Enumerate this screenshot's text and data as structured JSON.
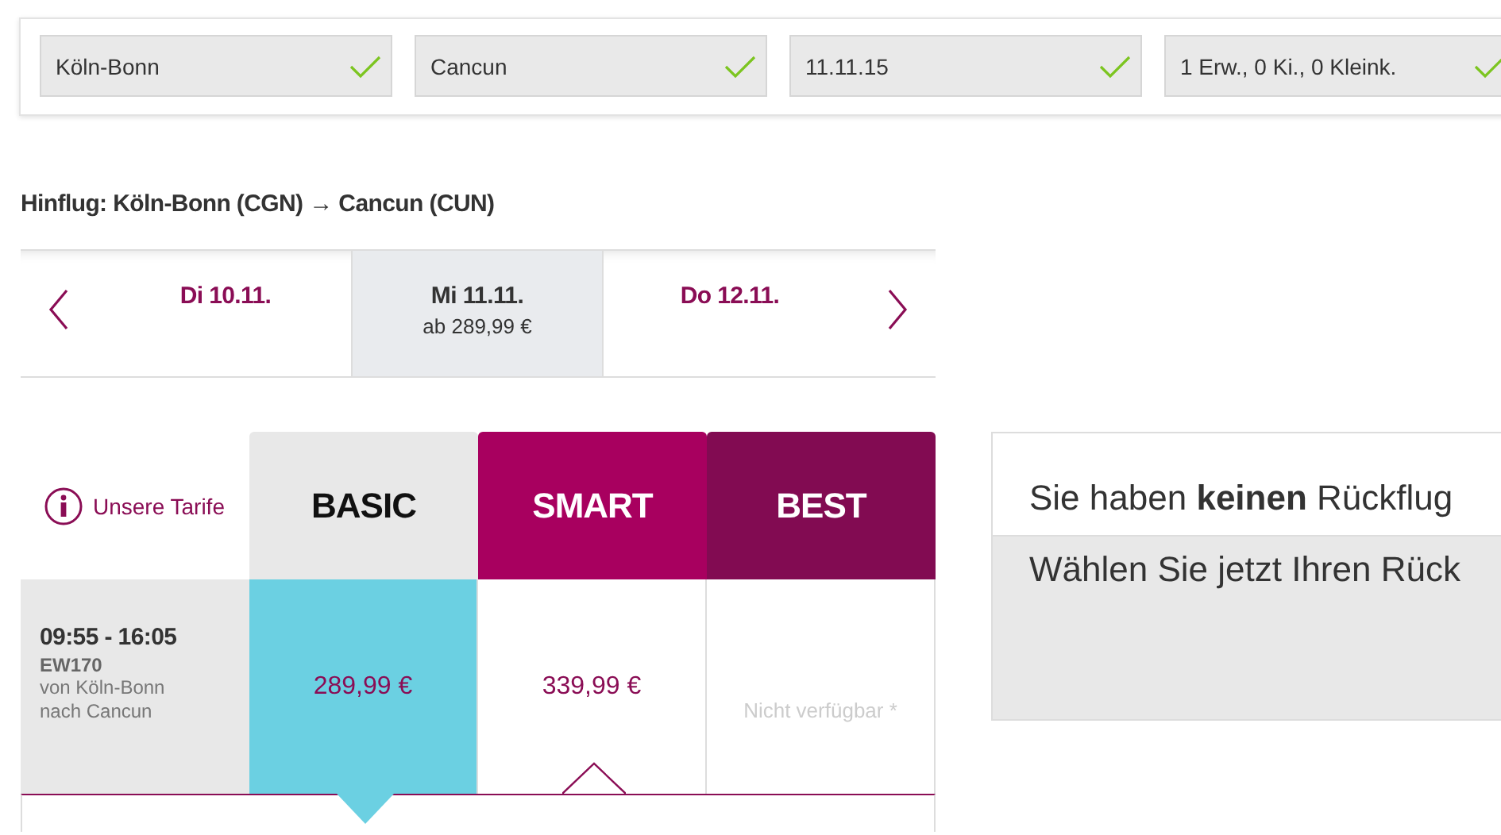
{
  "search_fields": [
    {
      "value": "Köln-Bonn",
      "valid": true
    },
    {
      "value": "Cancun",
      "valid": true
    },
    {
      "value": "11.11.15",
      "valid": true
    },
    {
      "value": "1 Erw., 0 Ki., 0 Kleink.",
      "valid": true
    }
  ],
  "outbound": {
    "heading": "Hinflug: Köln-Bonn (CGN) → Cancun (CUN)",
    "days": [
      {
        "label": "Di 10.11.",
        "selected": false
      },
      {
        "label": "Mi 11.11.",
        "price": "ab 289,99 €",
        "selected": true
      },
      {
        "label": "Do 12.11.",
        "selected": false
      }
    ]
  },
  "fares": {
    "info_link": "Unsere Tarife",
    "columns": [
      {
        "name": "BASIC",
        "color": "#e8e8e8"
      },
      {
        "name": "SMART",
        "color": "#a8005f"
      },
      {
        "name": "BEST",
        "color": "#820b52"
      }
    ],
    "flight": {
      "time": "09:55 - 16:05",
      "number": "EW170",
      "route": "von Köln-Bonn\nnach Cancun"
    },
    "cells": [
      {
        "kind": "price",
        "text": "289,99 €",
        "selected": true
      },
      {
        "kind": "price",
        "text": "339,99 €",
        "selected": false
      },
      {
        "kind": "unavailable",
        "text": "Nicht verfügbar *",
        "selected": false
      }
    ]
  },
  "return": {
    "message": "Sie haben **keinen** Rückflug",
    "prompt": "Wählen Sie jetzt Ihren Rück"
  }
}
